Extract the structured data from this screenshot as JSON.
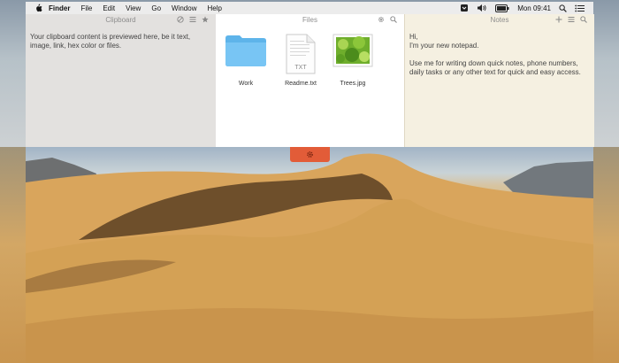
{
  "menubar": {
    "app_name": "Finder",
    "menus": [
      "File",
      "Edit",
      "View",
      "Go",
      "Window",
      "Help"
    ],
    "clock": "Mon 09:41"
  },
  "clipboard": {
    "title": "Clipboard",
    "text": "Your clipboard content is previewed here, be it text, image, link, hex color or files."
  },
  "files": {
    "title": "Files",
    "items": [
      {
        "label": "Work",
        "type": "folder"
      },
      {
        "label": "Readme.txt",
        "type": "text-document",
        "badge": "TXT"
      },
      {
        "label": "Trees.jpg",
        "type": "image"
      }
    ]
  },
  "notes": {
    "title": "Notes",
    "lines": [
      "Hi,",
      "I'm your new notepad.",
      "Use me for writing down quick notes, phone numbers, daily tasks or any other text for quick and easy access."
    ]
  },
  "colors": {
    "accent_tab": "#e25c38",
    "folder_blue": "#6cc0f3",
    "notes_bg": "#f5f0e1",
    "clipboard_bg": "#e3e1df"
  }
}
